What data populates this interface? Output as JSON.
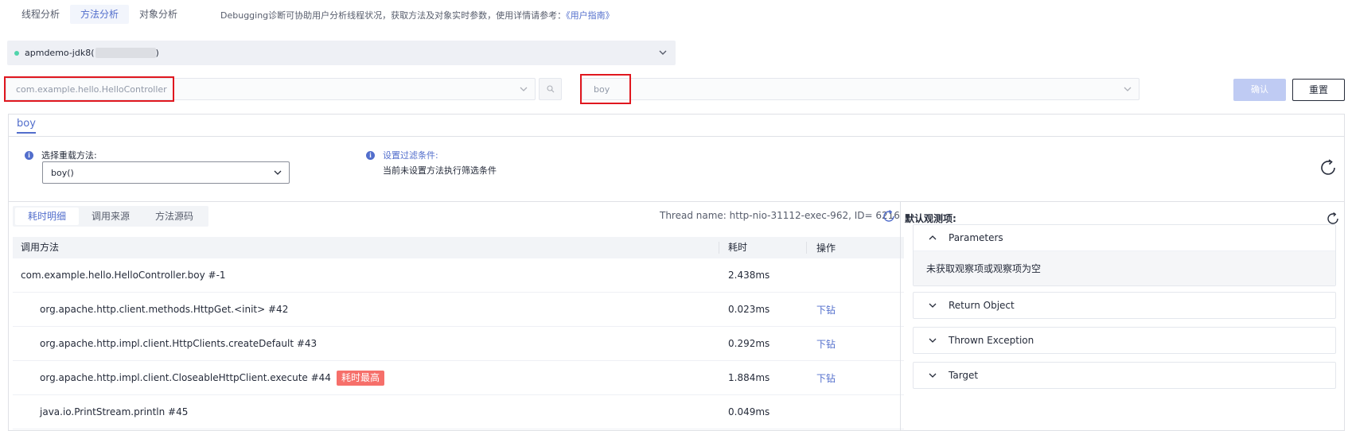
{
  "top": {
    "tabs": [
      {
        "label": "线程分析",
        "active": false
      },
      {
        "label": "方法分析",
        "active": true
      },
      {
        "label": "对象分析",
        "active": false
      }
    ],
    "description": "Debugging诊断可协助用户分析线程状况，获取方法及对象实时参数，使用详情请参考：",
    "guide_link": "《用户指南》"
  },
  "app": {
    "name": "apmdemo-jdk8(",
    "suffix": ")",
    "status_color": "#50d4ab"
  },
  "filters": {
    "class_value": "com.example.hello.HelloController",
    "method_value": "boy",
    "confirm_label": "确认",
    "reset_label": "重置"
  },
  "panel": {
    "method_tab": "boy",
    "overload_label": "选择重载方法:",
    "overload_value": "boy()",
    "filter_title": "设置过滤条件:",
    "filter_desc": "当前未设置方法执行筛选条件"
  },
  "detail": {
    "subtabs": [
      {
        "label": "耗时明细",
        "active": true
      },
      {
        "label": "调用来源",
        "active": false
      },
      {
        "label": "方法源码",
        "active": false
      }
    ],
    "thread_info": "Thread name: http-nio-31112-exec-962, ID= 6216",
    "table": {
      "headers": {
        "method": "调用方法",
        "time": "耗时",
        "action": "操作"
      },
      "rows": [
        {
          "method": "com.example.hello.HelloController.boy #-1",
          "time": "2.438ms",
          "action": "",
          "badge": "",
          "indent": false
        },
        {
          "method": "org.apache.http.client.methods.HttpGet.<init> #42",
          "time": "0.023ms",
          "action": "下钻",
          "badge": "",
          "indent": true
        },
        {
          "method": "org.apache.http.impl.client.HttpClients.createDefault #43",
          "time": "0.292ms",
          "action": "下钻",
          "badge": "",
          "indent": true
        },
        {
          "method": "org.apache.http.impl.client.CloseableHttpClient.execute #44",
          "time": "1.884ms",
          "action": "下钻",
          "badge": "耗时最高",
          "indent": true
        },
        {
          "method": "java.io.PrintStream.println #45",
          "time": "0.049ms",
          "action": "",
          "badge": "",
          "indent": true
        }
      ]
    }
  },
  "observe": {
    "title": "默认观测项:",
    "items": [
      {
        "label": "Parameters",
        "expanded": true,
        "body": "未获取观察项或观察项为空"
      },
      {
        "label": "Return Object",
        "expanded": false
      },
      {
        "label": "Thrown Exception",
        "expanded": false
      },
      {
        "label": "Target",
        "expanded": false
      }
    ]
  },
  "colors": {
    "accent": "#526ecc",
    "highlight_border": "#e0171f",
    "badge_bg": "#f66f6a",
    "confirm_disabled": "#bfcbf3"
  }
}
